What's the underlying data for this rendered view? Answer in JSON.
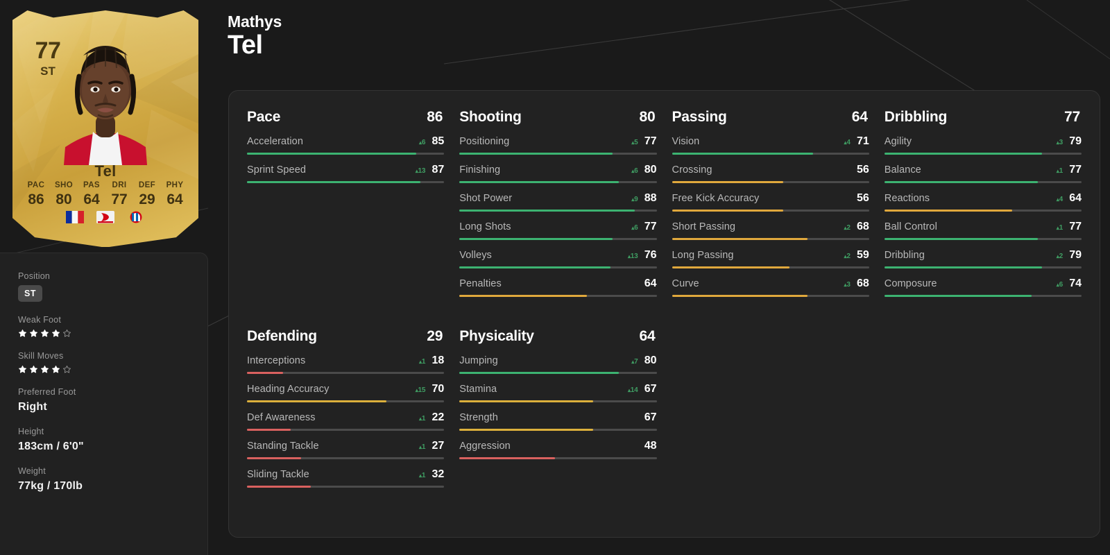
{
  "player": {
    "first_name": "Mathys",
    "last_name": "Tel",
    "card": {
      "rating": "77",
      "position": "ST",
      "name": "Tel",
      "stats": [
        {
          "label": "PAC",
          "value": "86"
        },
        {
          "label": "SHO",
          "value": "80"
        },
        {
          "label": "PAS",
          "value": "64"
        },
        {
          "label": "DRI",
          "value": "77"
        },
        {
          "label": "DEF",
          "value": "29"
        },
        {
          "label": "PHY",
          "value": "64"
        }
      ],
      "badges": [
        "france-flag-icon",
        "bundesliga-logo-icon",
        "bayern-munich-crest-icon"
      ]
    }
  },
  "sidebar": {
    "position": {
      "label": "Position",
      "value": "ST"
    },
    "weak_foot": {
      "label": "Weak Foot",
      "filled": 4,
      "total": 5
    },
    "skill_moves": {
      "label": "Skill Moves",
      "filled": 4,
      "total": 5
    },
    "preferred_foot": {
      "label": "Preferred Foot",
      "value": "Right"
    },
    "height": {
      "label": "Height",
      "value": "183cm / 6'0\""
    },
    "weight": {
      "label": "Weight",
      "value": "77kg / 170lb"
    }
  },
  "colors": {
    "green": "#3cb371",
    "orange": "#e0a83c",
    "gold": "#dcb03c",
    "red": "#d9615f",
    "track": "#4b4b4b",
    "mod_green": "#3f9c62",
    "panel_bg": "#222222",
    "page_bg": "#1a1a1a"
  },
  "chart_data": {
    "type": "bar",
    "title": "Mathys Tel — Player Attributes",
    "max_value": 99,
    "groups": [
      {
        "name": "Pace",
        "value": 86,
        "row": 1,
        "col": 1,
        "stats": [
          {
            "name": "Acceleration",
            "value": 85,
            "mod": 6,
            "color": "green"
          },
          {
            "name": "Sprint Speed",
            "value": 87,
            "mod": 13,
            "color": "green"
          }
        ]
      },
      {
        "name": "Shooting",
        "value": 80,
        "row": 1,
        "col": 2,
        "stats": [
          {
            "name": "Positioning",
            "value": 77,
            "mod": 5,
            "color": "green"
          },
          {
            "name": "Finishing",
            "value": 80,
            "mod": 6,
            "color": "green"
          },
          {
            "name": "Shot Power",
            "value": 88,
            "mod": 9,
            "color": "green"
          },
          {
            "name": "Long Shots",
            "value": 77,
            "mod": 6,
            "color": "green"
          },
          {
            "name": "Volleys",
            "value": 76,
            "mod": 13,
            "color": "green"
          },
          {
            "name": "Penalties",
            "value": 64,
            "mod": null,
            "color": "orange"
          }
        ]
      },
      {
        "name": "Passing",
        "value": 64,
        "row": 1,
        "col": 3,
        "stats": [
          {
            "name": "Vision",
            "value": 71,
            "mod": 4,
            "color": "green"
          },
          {
            "name": "Crossing",
            "value": 56,
            "mod": null,
            "color": "orange"
          },
          {
            "name": "Free Kick Accuracy",
            "value": 56,
            "mod": null,
            "color": "orange"
          },
          {
            "name": "Short Passing",
            "value": 68,
            "mod": 2,
            "color": "orange"
          },
          {
            "name": "Long Passing",
            "value": 59,
            "mod": 2,
            "color": "orange"
          },
          {
            "name": "Curve",
            "value": 68,
            "mod": 3,
            "color": "orange"
          }
        ]
      },
      {
        "name": "Dribbling",
        "value": 77,
        "row": 1,
        "col": 4,
        "stats": [
          {
            "name": "Agility",
            "value": 79,
            "mod": 3,
            "color": "green"
          },
          {
            "name": "Balance",
            "value": 77,
            "mod": 1,
            "color": "green"
          },
          {
            "name": "Reactions",
            "value": 64,
            "mod": 4,
            "color": "orange"
          },
          {
            "name": "Ball Control",
            "value": 77,
            "mod": 1,
            "color": "green"
          },
          {
            "name": "Dribbling",
            "value": 79,
            "mod": 2,
            "color": "green"
          },
          {
            "name": "Composure",
            "value": 74,
            "mod": 6,
            "color": "green"
          }
        ]
      },
      {
        "name": "Defending",
        "value": 29,
        "row": 2,
        "col": 1,
        "stats": [
          {
            "name": "Interceptions",
            "value": 18,
            "mod": 1,
            "color": "red"
          },
          {
            "name": "Heading Accuracy",
            "value": 70,
            "mod": 15,
            "color": "gold"
          },
          {
            "name": "Def Awareness",
            "value": 22,
            "mod": 1,
            "color": "red"
          },
          {
            "name": "Standing Tackle",
            "value": 27,
            "mod": 1,
            "color": "red"
          },
          {
            "name": "Sliding Tackle",
            "value": 32,
            "mod": 1,
            "color": "red"
          }
        ]
      },
      {
        "name": "Physicality",
        "value": 64,
        "row": 2,
        "col": 2,
        "stats": [
          {
            "name": "Jumping",
            "value": 80,
            "mod": 7,
            "color": "green"
          },
          {
            "name": "Stamina",
            "value": 67,
            "mod": 14,
            "color": "gold"
          },
          {
            "name": "Strength",
            "value": 67,
            "mod": null,
            "color": "gold"
          },
          {
            "name": "Aggression",
            "value": 48,
            "mod": null,
            "color": "red"
          }
        ]
      }
    ]
  }
}
